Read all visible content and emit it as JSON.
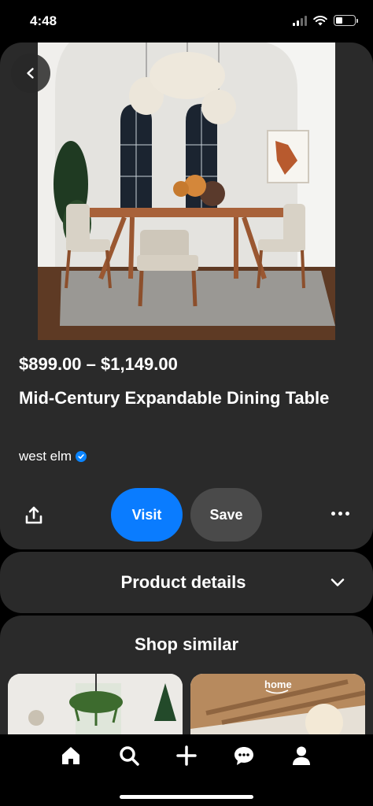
{
  "status": {
    "time": "4:48"
  },
  "product": {
    "price": "$899.00 – $1,149.00",
    "title": "Mid-Century Expandable Dining Table",
    "brand": "west elm"
  },
  "actions": {
    "visit_label": "Visit",
    "save_label": "Save"
  },
  "sections": {
    "details_label": "Product details",
    "similar_label": "Shop similar"
  },
  "similar_items": [
    {
      "badge": ""
    },
    {
      "badge": "home"
    }
  ],
  "colors": {
    "accent": "#0a7cff",
    "card": "#2a2a2a",
    "verified": "#0a84ff"
  },
  "icons": [
    "back-chevron-icon",
    "verified-icon",
    "share-icon",
    "more-icon",
    "chevron-down-icon",
    "home-icon",
    "search-icon",
    "plus-icon",
    "chat-icon",
    "profile-icon"
  ]
}
